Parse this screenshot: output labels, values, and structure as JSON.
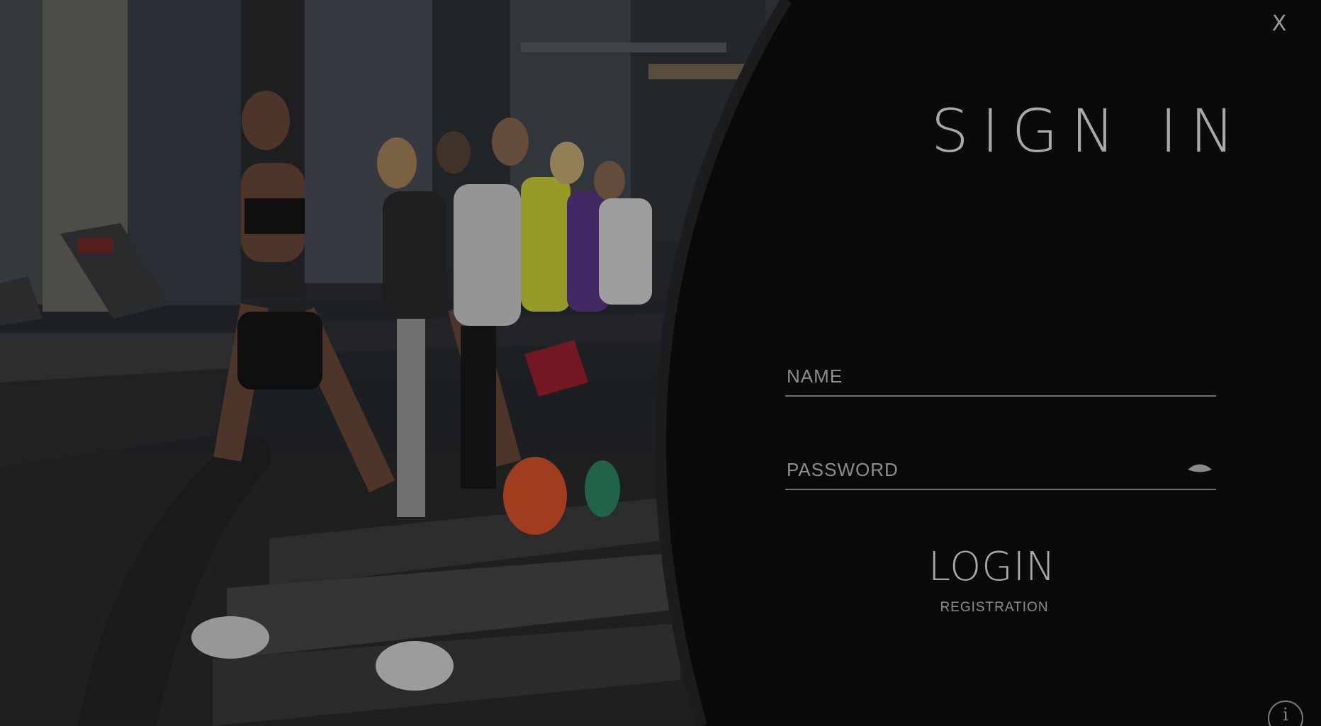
{
  "signin": {
    "title": "SIGN IN",
    "close_label": "X",
    "name_placeholder": "NAME",
    "password_placeholder": "PASSWORD",
    "login_label": "LOGIN",
    "registration_label": "REGISTRATION",
    "info_label": "i"
  },
  "icons": {
    "close": "close-icon",
    "password_visibility": "eye-icon",
    "info": "info-icon"
  },
  "colors": {
    "panel_background": "#0a0a0b",
    "text_primary": "#a8a8a8",
    "field_underline": "#6f6f6f"
  }
}
